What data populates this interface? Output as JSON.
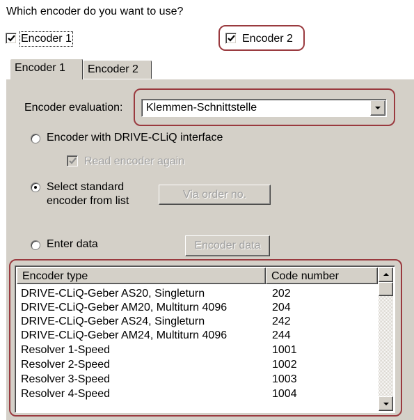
{
  "question": "Which encoder do you want to use?",
  "checkboxes": {
    "encoder1": {
      "label": "Encoder 1",
      "checked": true
    },
    "encoder2": {
      "label": "Encoder 2",
      "checked": true
    }
  },
  "tabs": [
    {
      "label": "Encoder 1",
      "active": true
    },
    {
      "label": "Encoder 2",
      "active": false
    }
  ],
  "evaluation": {
    "label": "Encoder evaluation:",
    "value": "Klemmen-Schnittstelle"
  },
  "options": {
    "drive_cliq": {
      "label": "Encoder with DRIVE-CLiQ interface",
      "selected": false
    },
    "read_again": {
      "label": "Read encoder again",
      "checked": true,
      "enabled": false
    },
    "standard": {
      "label_line1": "Select standard",
      "label_line2": "encoder from list",
      "selected": true
    },
    "via_order_button": "Via order no.",
    "enter_data": {
      "label": "Enter data",
      "selected": false
    },
    "encoder_data_button": "Encoder data"
  },
  "table": {
    "columns": [
      "Encoder type",
      "Code number"
    ],
    "rows": [
      {
        "type": "DRIVE-CLiQ-Geber AS20, Singleturn",
        "code": "202"
      },
      {
        "type": "DRIVE-CLiQ-Geber AM20, Multiturn 4096",
        "code": "204"
      },
      {
        "type": "DRIVE-CLiQ-Geber AS24, Singleturn",
        "code": "242"
      },
      {
        "type": "DRIVE-CLiQ-Geber AM24, Multiturn 4096",
        "code": "244"
      },
      {
        "type": "Resolver 1-Speed",
        "code": "1001"
      },
      {
        "type": "Resolver 2-Speed",
        "code": "1002"
      },
      {
        "type": "Resolver 3-Speed",
        "code": "1003"
      },
      {
        "type": "Resolver 4-Speed",
        "code": "1004"
      }
    ]
  },
  "icons": {
    "checkmark": "check-icon",
    "scroll_up": "arrow-up-icon",
    "scroll_down": "arrow-down-icon",
    "dropdown": "chevron-down-icon"
  },
  "colors": {
    "dialog_bg": "#d4d0c8",
    "highlight": "#9a3a3f",
    "disabled_text": "#a0a0a0"
  }
}
